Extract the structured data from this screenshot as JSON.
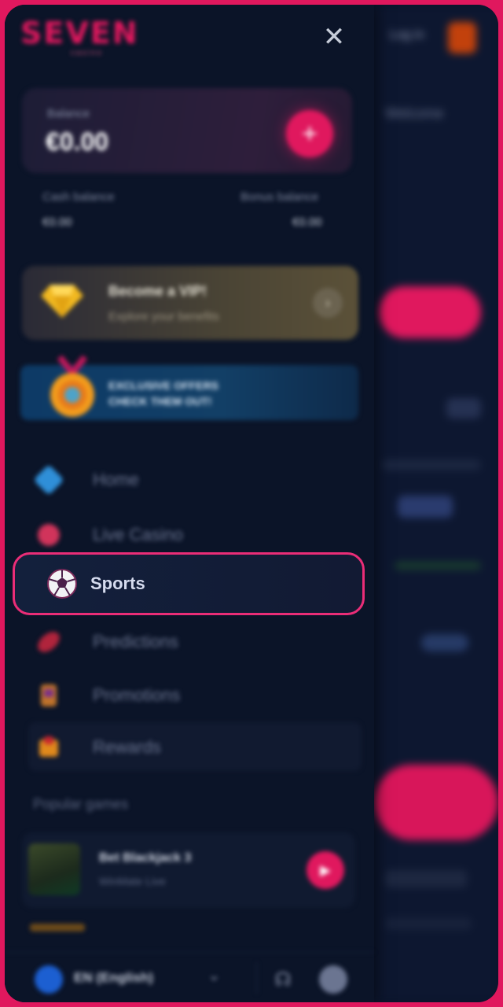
{
  "brand": {
    "name": "SEVEN",
    "tagline": "casino"
  },
  "balance": {
    "label": "Balance",
    "amount": "€0.00",
    "cash_label": "Cash balance",
    "cash_value": "€0.00",
    "bonus_label": "Bonus balance",
    "bonus_value": "€0.00"
  },
  "vip": {
    "title": "Become a VIP!",
    "subtitle": "Explore your benefits"
  },
  "offer": {
    "line1": "EXCLUSIVE OFFERS",
    "line2": "CHECK THEM OUT!"
  },
  "nav": {
    "home": "Home",
    "live_casino": "Live Casino",
    "sports": "Sports",
    "predictions": "Predictions",
    "promotions": "Promotions",
    "rewards": "Rewards"
  },
  "popular": {
    "heading": "Popular games",
    "game_title": "Bet Blackjack 3",
    "game_provider": "WinMate Live"
  },
  "footer": {
    "language": "EN (English)"
  },
  "background": {
    "login": "Log in",
    "title": "Welcome"
  },
  "colors": {
    "accent": "#e0185e",
    "bg": "#0b1428"
  }
}
